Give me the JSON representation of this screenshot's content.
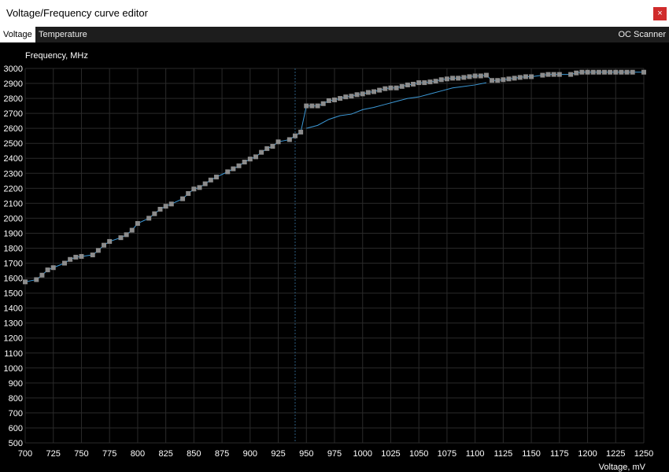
{
  "window": {
    "title": "Voltage/Frequency curve editor",
    "close_label": "×"
  },
  "tabs": [
    {
      "label": "Voltage",
      "active": true
    },
    {
      "label": "Temperature",
      "active": false
    }
  ],
  "oc_scanner_label": "OC Scanner",
  "colors": {
    "background": "#000000",
    "grid": "#2a2a2a",
    "curve": "#3d9ad8",
    "point": "#8c8c8c",
    "axis_text": "#ffffff",
    "cursor_line": "#2c5d80"
  },
  "chart_data": {
    "type": "line",
    "ylabel": "Frequency, MHz",
    "xlabel": "Voltage, mV",
    "xlim": [
      700,
      1250
    ],
    "ylim": [
      500,
      3000
    ],
    "xticks": [
      700,
      725,
      750,
      775,
      800,
      825,
      850,
      875,
      900,
      925,
      950,
      975,
      1000,
      1025,
      1050,
      1075,
      1100,
      1125,
      1150,
      1175,
      1200,
      1225,
      1250
    ],
    "yticks": [
      500,
      600,
      700,
      800,
      900,
      1000,
      1100,
      1200,
      1300,
      1400,
      1500,
      1600,
      1700,
      1800,
      1900,
      2000,
      2100,
      2200,
      2300,
      2400,
      2500,
      2600,
      2700,
      2800,
      2900,
      3000
    ],
    "grid": true,
    "current_voltage_marker": 940,
    "series": [
      {
        "x": [
          700,
          710,
          715,
          720,
          725,
          735,
          740,
          745,
          750,
          760,
          765,
          770,
          775,
          785,
          790,
          795,
          800,
          810,
          815,
          820,
          825,
          830,
          840,
          845,
          850,
          855,
          860,
          865,
          870,
          880,
          885,
          890,
          895,
          900,
          905,
          910,
          915,
          920,
          925,
          935,
          940,
          945,
          950,
          955,
          960,
          965,
          970,
          975,
          980,
          985,
          990,
          995,
          1000,
          1005,
          1010,
          1015,
          1020,
          1025,
          1030,
          1035,
          1040,
          1045,
          1050,
          1055,
          1060,
          1065,
          1070,
          1075,
          1080,
          1085,
          1090,
          1095,
          1100,
          1105,
          1110,
          1115,
          1120,
          1125,
          1130,
          1135,
          1140,
          1145,
          1150,
          1160,
          1165,
          1170,
          1175,
          1185,
          1190,
          1195,
          1200,
          1205,
          1210,
          1215,
          1220,
          1225,
          1230,
          1235,
          1240,
          1250
        ],
        "y": [
          1575,
          1590,
          1620,
          1655,
          1670,
          1700,
          1725,
          1740,
          1745,
          1755,
          1785,
          1820,
          1845,
          1870,
          1890,
          1920,
          1965,
          2000,
          2030,
          2060,
          2080,
          2095,
          2130,
          2165,
          2195,
          2205,
          2230,
          2255,
          2275,
          2310,
          2330,
          2350,
          2375,
          2395,
          2410,
          2440,
          2465,
          2480,
          2510,
          2525,
          2550,
          2575,
          2750,
          2750,
          2750,
          2765,
          2785,
          2790,
          2800,
          2810,
          2815,
          2825,
          2830,
          2840,
          2845,
          2855,
          2865,
          2870,
          2870,
          2880,
          2890,
          2895,
          2905,
          2905,
          2910,
          2915,
          2925,
          2930,
          2935,
          2935,
          2940,
          2945,
          2950,
          2950,
          2955,
          2920,
          2920,
          2925,
          2930,
          2935,
          2940,
          2945,
          2945,
          2955,
          2960,
          2960,
          2960,
          2960,
          2970,
          2975,
          2975,
          2975,
          2975,
          2975,
          2975,
          2975,
          2975,
          2975,
          2975,
          2975
        ]
      },
      {
        "x": [
          950,
          960,
          970,
          980,
          990,
          1000,
          1010,
          1020,
          1030,
          1040,
          1050,
          1060,
          1070,
          1080,
          1090,
          1100,
          1110
        ],
        "y": [
          2600,
          2620,
          2660,
          2685,
          2695,
          2725,
          2740,
          2760,
          2780,
          2800,
          2810,
          2830,
          2850,
          2870,
          2880,
          2890,
          2905
        ]
      }
    ]
  }
}
